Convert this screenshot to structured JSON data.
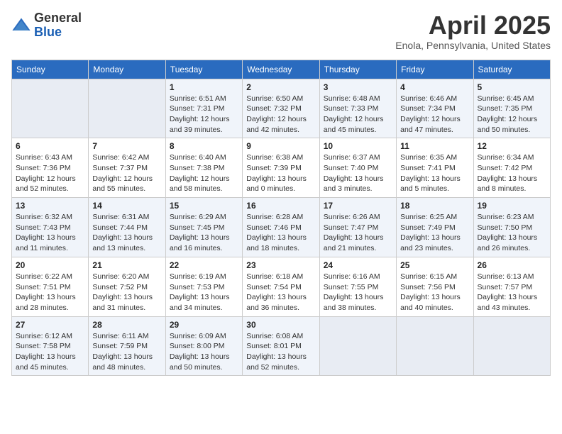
{
  "header": {
    "logo_general": "General",
    "logo_blue": "Blue",
    "title": "April 2025",
    "location": "Enola, Pennsylvania, United States"
  },
  "days_of_week": [
    "Sunday",
    "Monday",
    "Tuesday",
    "Wednesday",
    "Thursday",
    "Friday",
    "Saturday"
  ],
  "weeks": [
    [
      {
        "day": "",
        "empty": true
      },
      {
        "day": "",
        "empty": true
      },
      {
        "day": "1",
        "sunrise": "6:51 AM",
        "sunset": "7:31 PM",
        "daylight": "12 hours and 39 minutes."
      },
      {
        "day": "2",
        "sunrise": "6:50 AM",
        "sunset": "7:32 PM",
        "daylight": "12 hours and 42 minutes."
      },
      {
        "day": "3",
        "sunrise": "6:48 AM",
        "sunset": "7:33 PM",
        "daylight": "12 hours and 45 minutes."
      },
      {
        "day": "4",
        "sunrise": "6:46 AM",
        "sunset": "7:34 PM",
        "daylight": "12 hours and 47 minutes."
      },
      {
        "day": "5",
        "sunrise": "6:45 AM",
        "sunset": "7:35 PM",
        "daylight": "12 hours and 50 minutes."
      }
    ],
    [
      {
        "day": "6",
        "sunrise": "6:43 AM",
        "sunset": "7:36 PM",
        "daylight": "12 hours and 52 minutes."
      },
      {
        "day": "7",
        "sunrise": "6:42 AM",
        "sunset": "7:37 PM",
        "daylight": "12 hours and 55 minutes."
      },
      {
        "day": "8",
        "sunrise": "6:40 AM",
        "sunset": "7:38 PM",
        "daylight": "12 hours and 58 minutes."
      },
      {
        "day": "9",
        "sunrise": "6:38 AM",
        "sunset": "7:39 PM",
        "daylight": "13 hours and 0 minutes."
      },
      {
        "day": "10",
        "sunrise": "6:37 AM",
        "sunset": "7:40 PM",
        "daylight": "13 hours and 3 minutes."
      },
      {
        "day": "11",
        "sunrise": "6:35 AM",
        "sunset": "7:41 PM",
        "daylight": "13 hours and 5 minutes."
      },
      {
        "day": "12",
        "sunrise": "6:34 AM",
        "sunset": "7:42 PM",
        "daylight": "13 hours and 8 minutes."
      }
    ],
    [
      {
        "day": "13",
        "sunrise": "6:32 AM",
        "sunset": "7:43 PM",
        "daylight": "13 hours and 11 minutes."
      },
      {
        "day": "14",
        "sunrise": "6:31 AM",
        "sunset": "7:44 PM",
        "daylight": "13 hours and 13 minutes."
      },
      {
        "day": "15",
        "sunrise": "6:29 AM",
        "sunset": "7:45 PM",
        "daylight": "13 hours and 16 minutes."
      },
      {
        "day": "16",
        "sunrise": "6:28 AM",
        "sunset": "7:46 PM",
        "daylight": "13 hours and 18 minutes."
      },
      {
        "day": "17",
        "sunrise": "6:26 AM",
        "sunset": "7:47 PM",
        "daylight": "13 hours and 21 minutes."
      },
      {
        "day": "18",
        "sunrise": "6:25 AM",
        "sunset": "7:49 PM",
        "daylight": "13 hours and 23 minutes."
      },
      {
        "day": "19",
        "sunrise": "6:23 AM",
        "sunset": "7:50 PM",
        "daylight": "13 hours and 26 minutes."
      }
    ],
    [
      {
        "day": "20",
        "sunrise": "6:22 AM",
        "sunset": "7:51 PM",
        "daylight": "13 hours and 28 minutes."
      },
      {
        "day": "21",
        "sunrise": "6:20 AM",
        "sunset": "7:52 PM",
        "daylight": "13 hours and 31 minutes."
      },
      {
        "day": "22",
        "sunrise": "6:19 AM",
        "sunset": "7:53 PM",
        "daylight": "13 hours and 34 minutes."
      },
      {
        "day": "23",
        "sunrise": "6:18 AM",
        "sunset": "7:54 PM",
        "daylight": "13 hours and 36 minutes."
      },
      {
        "day": "24",
        "sunrise": "6:16 AM",
        "sunset": "7:55 PM",
        "daylight": "13 hours and 38 minutes."
      },
      {
        "day": "25",
        "sunrise": "6:15 AM",
        "sunset": "7:56 PM",
        "daylight": "13 hours and 40 minutes."
      },
      {
        "day": "26",
        "sunrise": "6:13 AM",
        "sunset": "7:57 PM",
        "daylight": "13 hours and 43 minutes."
      }
    ],
    [
      {
        "day": "27",
        "sunrise": "6:12 AM",
        "sunset": "7:58 PM",
        "daylight": "13 hours and 45 minutes."
      },
      {
        "day": "28",
        "sunrise": "6:11 AM",
        "sunset": "7:59 PM",
        "daylight": "13 hours and 48 minutes."
      },
      {
        "day": "29",
        "sunrise": "6:09 AM",
        "sunset": "8:00 PM",
        "daylight": "13 hours and 50 minutes."
      },
      {
        "day": "30",
        "sunrise": "6:08 AM",
        "sunset": "8:01 PM",
        "daylight": "13 hours and 52 minutes."
      },
      {
        "day": "",
        "empty": true
      },
      {
        "day": "",
        "empty": true
      },
      {
        "day": "",
        "empty": true
      }
    ]
  ],
  "labels": {
    "sunrise": "Sunrise:",
    "sunset": "Sunset:",
    "daylight": "Daylight:"
  }
}
